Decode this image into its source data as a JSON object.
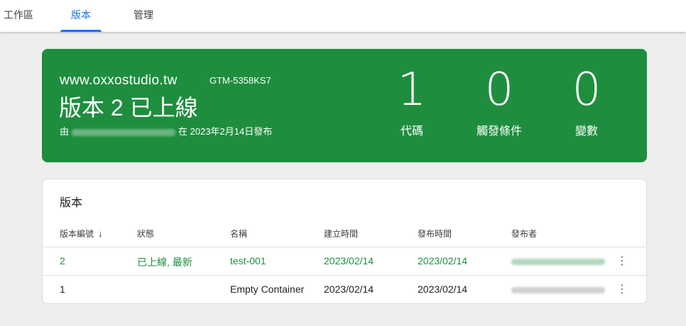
{
  "tabs": [
    {
      "label": "工作區",
      "active": false
    },
    {
      "label": "版本",
      "active": true
    },
    {
      "label": "管理",
      "active": false
    }
  ],
  "hero": {
    "site": "www.oxxostudio.tw",
    "container_id": "GTM-5358KS7",
    "title": "版本 2 已上線",
    "published_prefix": "由",
    "published_suffix": "在 2023年2月14日發布",
    "stats": [
      {
        "value": "1",
        "label": "代碼"
      },
      {
        "value": "0",
        "label": "觸發條件"
      },
      {
        "value": "0",
        "label": "變數"
      }
    ],
    "color": "#1e8e3e"
  },
  "versions": {
    "title": "版本",
    "columns": [
      "版本編號",
      "狀態",
      "名稱",
      "建立時間",
      "發布時間",
      "發布者"
    ],
    "sort_icon": "arrow-down-icon",
    "rows": [
      {
        "number": "2",
        "status": "已上線, 最新",
        "name": "test-001",
        "created": "2023/02/14",
        "published": "2023/02/14",
        "live": true
      },
      {
        "number": "1",
        "status": "",
        "name": "Empty Container",
        "created": "2023/02/14",
        "published": "2023/02/14",
        "live": false
      }
    ],
    "live_color": "#1e8e3e",
    "menu_icon": "more-vert-icon"
  }
}
